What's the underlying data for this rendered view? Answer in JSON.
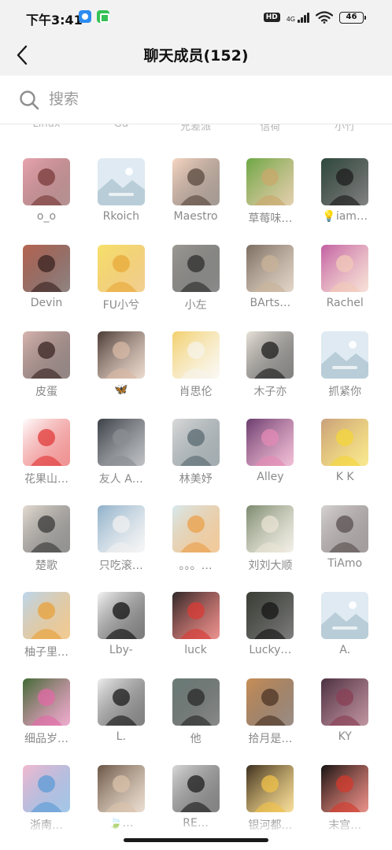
{
  "status_bar": {
    "time": "下午3:41",
    "hd": "HD",
    "network": "4G",
    "battery": "46",
    "icons": [
      "app-notification-blue-icon",
      "app-notification-green-icon",
      "hd-icon",
      "cellular-signal-icon",
      "wifi-icon",
      "battery-icon"
    ]
  },
  "header": {
    "title": "聊天成员(152)",
    "back_icon": "chevron-left-icon"
  },
  "search": {
    "placeholder": "搜索",
    "icon": "search-icon"
  },
  "members": [
    {
      "name": "o_o",
      "avatar": {
        "bg": "#e9a5b0",
        "accent": "#7a3b3b"
      }
    },
    {
      "name": "Rkoich",
      "avatar": {
        "bg": "#dfeaf2",
        "accent": "#b8cdd8",
        "placeholder": true
      }
    },
    {
      "name": "Maestro",
      "avatar": {
        "bg": "#f8d7c4",
        "accent": "#5a4a3f"
      }
    },
    {
      "name": "草莓味…",
      "avatar": {
        "bg": "#6ca845",
        "accent": "#c9a86b"
      }
    },
    {
      "name": "💡iam…",
      "avatar": {
        "bg": "#2f4a3d",
        "accent": "#1d1d1d"
      }
    },
    {
      "name": "Devin",
      "avatar": {
        "bg": "#b86552",
        "accent": "#3a2320"
      }
    },
    {
      "name": "FU小兮",
      "avatar": {
        "bg": "#f6e16b",
        "accent": "#e8a93a"
      }
    },
    {
      "name": "小左",
      "avatar": {
        "bg": "#9c9a94",
        "accent": "#2d2d2d"
      }
    },
    {
      "name": "BArts…",
      "avatar": {
        "bg": "#7b6e62",
        "accent": "#c9b39a"
      }
    },
    {
      "name": "Rachel",
      "avatar": {
        "bg": "#c25fa3",
        "accent": "#f1c9b8"
      }
    },
    {
      "name": "皮蛋",
      "avatar": {
        "bg": "#d9b6b0",
        "accent": "#3b2624"
      }
    },
    {
      "name": "🦋",
      "avatar": {
        "bg": "#4a3b36",
        "accent": "#d8b9a5"
      }
    },
    {
      "name": "肖思伦",
      "avatar": {
        "bg": "#f3d06d",
        "accent": "#f6f3ea"
      }
    },
    {
      "name": "木子亦",
      "avatar": {
        "bg": "#e9e3da",
        "accent": "#1e1e1e"
      }
    },
    {
      "name": "抓紧你",
      "avatar": {
        "bg": "#dfeaf2",
        "accent": "#b8cdd8",
        "placeholder": true
      }
    },
    {
      "name": "花果山…",
      "avatar": {
        "bg": "#ffffff",
        "accent": "#e23b3b"
      }
    },
    {
      "name": "友人 A…",
      "avatar": {
        "bg": "#3c4148",
        "accent": "#8b8f94"
      }
    },
    {
      "name": "林美妤",
      "avatar": {
        "bg": "#dbdbdb",
        "accent": "#5a6b72"
      }
    },
    {
      "name": "Alley",
      "avatar": {
        "bg": "#6a3d6e",
        "accent": "#e38ab4"
      }
    },
    {
      "name": "K K",
      "avatar": {
        "bg": "#c89f7e",
        "accent": "#f4d63a"
      }
    },
    {
      "name": "楚歌",
      "avatar": {
        "bg": "#e5ddd3",
        "accent": "#3a3a3a"
      }
    },
    {
      "name": "只吃滚…",
      "avatar": {
        "bg": "#8fb0c9",
        "accent": "#f0f0f0"
      }
    },
    {
      "name": "。。。…",
      "avatar": {
        "bg": "#d7e9ee",
        "accent": "#e9a04b"
      }
    },
    {
      "name": "刘刘大顺",
      "avatar": {
        "bg": "#7c8a6e",
        "accent": "#e9e3d4"
      }
    },
    {
      "name": "TiAmo",
      "avatar": {
        "bg": "#d8d3d3",
        "accent": "#5a5050"
      }
    },
    {
      "name": "柚子里…",
      "avatar": {
        "bg": "#bcd7ef",
        "accent": "#e8a13b"
      }
    },
    {
      "name": "Lby-",
      "avatar": {
        "bg": "#f5f5f5",
        "accent": "#111111"
      }
    },
    {
      "name": "luck",
      "avatar": {
        "bg": "#2e2a2a",
        "accent": "#d93b35"
      }
    },
    {
      "name": "Lucky…",
      "avatar": {
        "bg": "#3a3f34",
        "accent": "#151515"
      }
    },
    {
      "name": "A.",
      "avatar": {
        "bg": "#dfeaf2",
        "accent": "#b8cdd8",
        "placeholder": true
      }
    },
    {
      "name": "细品岁…",
      "avatar": {
        "bg": "#3f6b33",
        "accent": "#e16aa6"
      }
    },
    {
      "name": "L.",
      "avatar": {
        "bg": "#efefef",
        "accent": "#1b1b1b"
      }
    },
    {
      "name": "他",
      "avatar": {
        "bg": "#6b7d78",
        "accent": "#2a2a2a"
      }
    },
    {
      "name": "拾月是…",
      "avatar": {
        "bg": "#c98f56",
        "accent": "#4c3425"
      }
    },
    {
      "name": "KY",
      "avatar": {
        "bg": "#4b3140",
        "accent": "#8a3f56"
      }
    },
    {
      "name": "浙南…",
      "avatar": {
        "bg": "#f3b9cf",
        "accent": "#5c9bd6"
      }
    },
    {
      "name": "🍃…",
      "avatar": {
        "bg": "#6b5646",
        "accent": "#d9c2aa"
      }
    },
    {
      "name": "RE…",
      "avatar": {
        "bg": "#d9d9d9",
        "accent": "#1e1e1e"
      }
    },
    {
      "name": "银河都…",
      "avatar": {
        "bg": "#3b2e1f",
        "accent": "#f0c24a"
      }
    },
    {
      "name": "末宫…",
      "avatar": {
        "bg": "#141414",
        "accent": "#d33a2c"
      }
    }
  ],
  "clipped_top_row": [
    "Linux",
    "Gu",
    "允差派",
    "信荷",
    "小竹"
  ],
  "colors": {
    "header_bg": "#f2f2f2",
    "name_text": "#8a8a8a",
    "title_text": "#111111"
  }
}
